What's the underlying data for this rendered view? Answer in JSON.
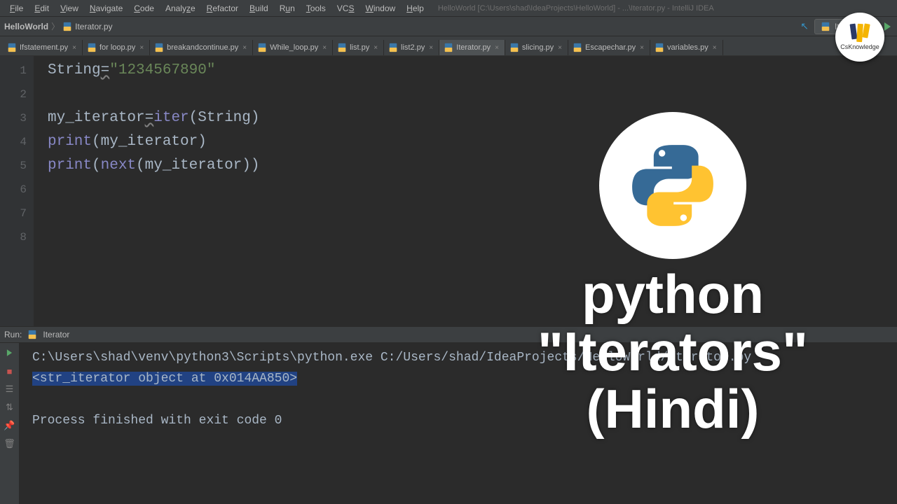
{
  "menubar": {
    "items": [
      {
        "label": "File",
        "mn": "F"
      },
      {
        "label": "Edit",
        "mn": "E"
      },
      {
        "label": "View",
        "mn": "V"
      },
      {
        "label": "Navigate",
        "mn": "N"
      },
      {
        "label": "Code",
        "mn": "C"
      },
      {
        "label": "Analyze",
        "mn": ""
      },
      {
        "label": "Refactor",
        "mn": "R"
      },
      {
        "label": "Build",
        "mn": "B"
      },
      {
        "label": "Run",
        "mn": ""
      },
      {
        "label": "Tools",
        "mn": "T"
      },
      {
        "label": "VCS",
        "mn": ""
      },
      {
        "label": "Window",
        "mn": "W"
      },
      {
        "label": "Help",
        "mn": "H"
      }
    ],
    "title": "HelloWorld [C:\\Users\\shad\\IdeaProjects\\HelloWorld] - ...\\Iterator.py - IntelliJ IDEA"
  },
  "breadcrumb": {
    "project": "HelloWorld",
    "file": "Iterator.py"
  },
  "run_config": {
    "label": "Iterator"
  },
  "tabs": [
    {
      "label": "Ifstatement.py",
      "active": false
    },
    {
      "label": "for loop.py",
      "active": false
    },
    {
      "label": "breakandcontinue.py",
      "active": false
    },
    {
      "label": "While_loop.py",
      "active": false
    },
    {
      "label": "list.py",
      "active": false
    },
    {
      "label": "list2.py",
      "active": false
    },
    {
      "label": "Iterator.py",
      "active": true
    },
    {
      "label": "slicing.py",
      "active": false
    },
    {
      "label": "Escapechar.py",
      "active": false
    },
    {
      "label": "variables.py",
      "active": false
    }
  ],
  "code": {
    "lines": [
      {
        "n": "1"
      },
      {
        "n": "2"
      },
      {
        "n": "3"
      },
      {
        "n": "4"
      },
      {
        "n": "5"
      },
      {
        "n": "6"
      },
      {
        "n": "7"
      },
      {
        "n": "8"
      }
    ],
    "l1a": "String",
    "l1eq": "=",
    "l1b": "\"1234567890\"",
    "l3a": "my_iterator",
    "l3eq": "=",
    "l3b": "iter",
    "l3c": "(String)",
    "l4a": "print",
    "l4b": "(my_iterator)",
    "l5a": "print",
    "l5b": "(",
    "l5c": "next",
    "l5d": "(my_iterator)",
    ")": ""
  },
  "run_panel": {
    "label": "Run:",
    "tab": "Iterator",
    "cmd": "C:\\Users\\shad\\venv\\python3\\Scripts\\python.exe C:/Users/shad/IdeaProjects/HelloWorld/Iterator.py",
    "out1": "<str_iterator object at 0x014AA850>",
    "out2": "",
    "exit": "Process finished with exit code 0"
  },
  "overlay": {
    "line1": "python",
    "line2": "\"Iterators\"",
    "line3": "(Hindi)"
  },
  "channel": {
    "name": "CsKnowledge"
  }
}
